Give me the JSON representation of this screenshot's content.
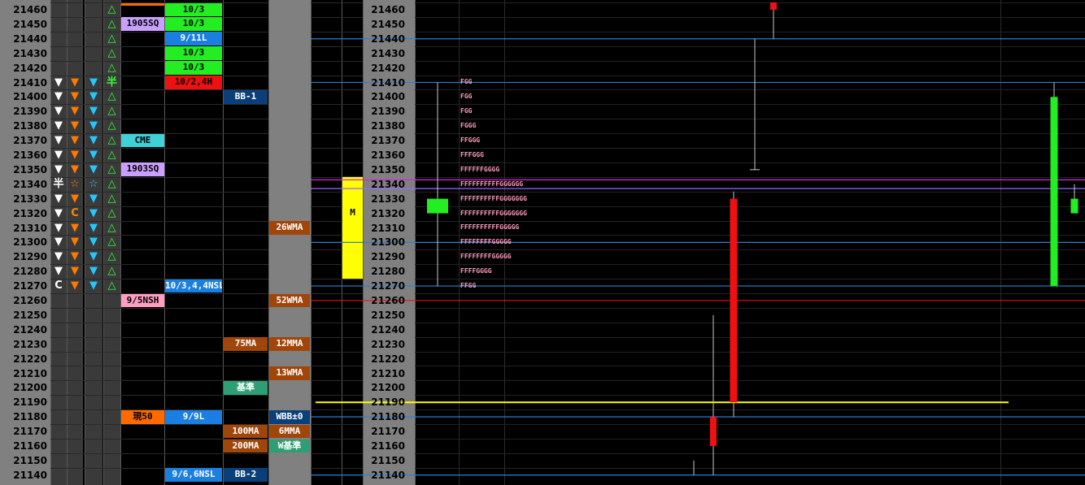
{
  "prices": [
    21460,
    21450,
    21440,
    21430,
    21420,
    21410,
    21400,
    21390,
    21380,
    21370,
    21360,
    21350,
    21340,
    21330,
    21320,
    21310,
    21300,
    21290,
    21280,
    21270,
    21260,
    21250,
    21240,
    21230,
    21220,
    21210,
    21200,
    21190,
    21180,
    21170,
    21160,
    21150,
    21140
  ],
  "markers": [
    {
      "price": 21460,
      "c1": "",
      "c2": "",
      "c3": "",
      "c4": "△"
    },
    {
      "price": 21450,
      "c1": "",
      "c2": "",
      "c3": "",
      "c4": "△"
    },
    {
      "price": 21440,
      "c1": "",
      "c2": "",
      "c3": "",
      "c4": "△"
    },
    {
      "price": 21430,
      "c1": "",
      "c2": "",
      "c3": "",
      "c4": "△"
    },
    {
      "price": 21420,
      "c1": "",
      "c2": "",
      "c3": "",
      "c4": "△"
    },
    {
      "price": 21410,
      "c1": "▼",
      "c2": "▼",
      "c3": "▼",
      "c4": "半"
    },
    {
      "price": 21400,
      "c1": "▼",
      "c2": "▼",
      "c3": "▼",
      "c4": "△"
    },
    {
      "price": 21390,
      "c1": "▼",
      "c2": "▼",
      "c3": "▼",
      "c4": "△"
    },
    {
      "price": 21380,
      "c1": "▼",
      "c2": "▼",
      "c3": "▼",
      "c4": "△"
    },
    {
      "price": 21370,
      "c1": "▼",
      "c2": "▼",
      "c3": "▼",
      "c4": "△"
    },
    {
      "price": 21360,
      "c1": "▼",
      "c2": "▼",
      "c3": "▼",
      "c4": "△"
    },
    {
      "price": 21350,
      "c1": "▼",
      "c2": "▼",
      "c3": "▼",
      "c4": "△"
    },
    {
      "price": 21340,
      "c1": "半",
      "c2": "☆",
      "c3": "☆",
      "c4": "△"
    },
    {
      "price": 21330,
      "c1": "▼",
      "c2": "▼",
      "c3": "▼",
      "c4": "△"
    },
    {
      "price": 21320,
      "c1": "▼",
      "c2": "C",
      "c3": "▼",
      "c4": "△"
    },
    {
      "price": 21310,
      "c1": "▼",
      "c2": "▼",
      "c3": "▼",
      "c4": "△"
    },
    {
      "price": 21300,
      "c1": "▼",
      "c2": "▼",
      "c3": "▼",
      "c4": "△"
    },
    {
      "price": 21290,
      "c1": "▼",
      "c2": "▼",
      "c3": "▼",
      "c4": "△"
    },
    {
      "price": 21280,
      "c1": "▼",
      "c2": "▼",
      "c3": "▼",
      "c4": "△"
    },
    {
      "price": 21270,
      "c1": "C",
      "c2": "▼",
      "c3": "▼",
      "c4": "△"
    }
  ],
  "tags": [
    {
      "price": 21460,
      "col": "a",
      "text": "",
      "bg": "#ff6a00",
      "fg": "#000",
      "thin": true
    },
    {
      "price": 21450,
      "col": "a",
      "text": "1905SQ",
      "bg": "#c9a0ff",
      "fg": "#000"
    },
    {
      "price": 21370,
      "col": "a",
      "text": "CME",
      "bg": "#40d0d8",
      "fg": "#000"
    },
    {
      "price": 21350,
      "col": "a",
      "text": "1903SQ",
      "bg": "#c9a0ff",
      "fg": "#000"
    },
    {
      "price": 21260,
      "col": "a",
      "text": "9/5NSH",
      "bg": "#ff9ec0",
      "fg": "#000"
    },
    {
      "price": 21180,
      "col": "a",
      "text": "現50",
      "bg": "#ff6a00",
      "fg": "#000"
    },
    {
      "price": 21460,
      "col": "b",
      "text": "10/3",
      "bg": "#22ee22",
      "fg": "#000"
    },
    {
      "price": 21450,
      "col": "b",
      "text": "10/3",
      "bg": "#22ee22",
      "fg": "#000"
    },
    {
      "price": 21440,
      "col": "b",
      "text": "9/11L",
      "bg": "#1a7fe0",
      "fg": "#fff"
    },
    {
      "price": 21430,
      "col": "b",
      "text": "10/3",
      "bg": "#22ee22",
      "fg": "#000"
    },
    {
      "price": 21420,
      "col": "b",
      "text": "10/3",
      "bg": "#22ee22",
      "fg": "#000"
    },
    {
      "price": 21410,
      "col": "b",
      "text": "10/2,4H",
      "bg": "#ee1111",
      "fg": "#000"
    },
    {
      "price": 21270,
      "col": "b",
      "text": "10/3,4,4NSL",
      "bg": "#1a7fe0",
      "fg": "#fff"
    },
    {
      "price": 21180,
      "col": "b",
      "text": "9/9L",
      "bg": "#1a7fe0",
      "fg": "#fff"
    },
    {
      "price": 21140,
      "col": "b",
      "text": "9/6,6NSL",
      "bg": "#1a7fe0",
      "fg": "#fff"
    },
    {
      "price": 21400,
      "col": "c",
      "text": "BB-1",
      "bg": "#0b3f7a",
      "fg": "#fff"
    },
    {
      "price": 21230,
      "col": "c",
      "text": "75MA",
      "bg": "#a0460a",
      "fg": "#fff"
    },
    {
      "price": 21200,
      "col": "c",
      "text": "基準",
      "bg": "#2e9e74",
      "fg": "#fff"
    },
    {
      "price": 21170,
      "col": "c",
      "text": "100MA",
      "bg": "#a0460a",
      "fg": "#fff"
    },
    {
      "price": 21160,
      "col": "c",
      "text": "200MA",
      "bg": "#a0460a",
      "fg": "#fff"
    },
    {
      "price": 21140,
      "col": "c",
      "text": "BB-2",
      "bg": "#0b3f7a",
      "fg": "#fff"
    },
    {
      "price": 21310,
      "col": "d",
      "text": "26WMA",
      "bg": "#a0460a",
      "fg": "#fff"
    },
    {
      "price": 21260,
      "col": "d",
      "text": "52WMA",
      "bg": "#a0460a",
      "fg": "#fff"
    },
    {
      "price": 21230,
      "col": "d",
      "text": "12MMA",
      "bg": "#a0460a",
      "fg": "#fff"
    },
    {
      "price": 21210,
      "col": "d",
      "text": "13WMA",
      "bg": "#a0460a",
      "fg": "#fff"
    },
    {
      "price": 21180,
      "col": "d",
      "text": "WBB±0",
      "bg": "#0b3f7a",
      "fg": "#fff"
    },
    {
      "price": 21170,
      "col": "d",
      "text": "6MMA",
      "bg": "#a0460a",
      "fg": "#fff"
    },
    {
      "price": 21160,
      "col": "d",
      "text": "W基準",
      "bg": "#2e9e74",
      "fg": "#fff"
    }
  ],
  "value_area": {
    "top": 21340,
    "bottom": 21280,
    "label": "M",
    "color": "#ffff00"
  },
  "chart_data": {
    "type": "candlestick",
    "ylim": [
      21135,
      21465
    ],
    "tick_step": 10,
    "candles": [
      {
        "name": "c1",
        "open": 21330,
        "close": 21320,
        "high": 21410,
        "low": 21270,
        "color": "#22ee22"
      },
      {
        "name": "c2",
        "open": 21180,
        "close": 21160,
        "high": 21250,
        "low": 21140,
        "color": "#ee1111"
      },
      {
        "name": "c3",
        "open": 21330,
        "close": 21190,
        "high": 21335,
        "low": 21180,
        "color": "#ee1111"
      },
      {
        "name": "c4",
        "open": 21465,
        "close": 21460,
        "high": 21465,
        "low": 21440,
        "color": "#ee1111"
      },
      {
        "name": "c5",
        "open": 21400,
        "close": 21270,
        "high": 21410,
        "low": 21270,
        "color": "#22ee22"
      },
      {
        "name": "c6",
        "open": 21330,
        "close": 21320,
        "high": 21340,
        "low": 21320,
        "color": "#22ee22"
      }
    ],
    "wicks": [
      {
        "high": 21150,
        "low": 21140
      },
      {
        "high": 21440,
        "low": 21350
      }
    ],
    "levels": [
      {
        "price": 21440,
        "color": "#2a7fd0"
      },
      {
        "price": 21410,
        "color": "#2a7fd0"
      },
      {
        "price": 21343,
        "color": "#dd22dd"
      },
      {
        "price": 21337,
        "color": "#9966ff"
      },
      {
        "price": 21300,
        "color": "#2a7fd0"
      },
      {
        "price": 21270,
        "color": "#2a7fd0"
      },
      {
        "price": 21260,
        "color": "#ee1111"
      },
      {
        "price": 21190,
        "color": "#ffff00"
      },
      {
        "price": 21180,
        "color": "#2a7fd0"
      },
      {
        "price": 21140,
        "color": "#2a7fd0"
      }
    ],
    "tpo_rows": [
      {
        "price": 21410,
        "text": "FGG"
      },
      {
        "price": 21400,
        "text": "FGG"
      },
      {
        "price": 21390,
        "text": "FGG"
      },
      {
        "price": 21380,
        "text": "FGGG"
      },
      {
        "price": 21370,
        "text": "FFGGG"
      },
      {
        "price": 21360,
        "text": "FFFGGG"
      },
      {
        "price": 21350,
        "text": "FFFFFFGGGG"
      },
      {
        "price": 21340,
        "text": "FFFFFFFFFFGGGGGG"
      },
      {
        "price": 21330,
        "text": "FFFFFFFFFFGGGGGGG"
      },
      {
        "price": 21320,
        "text": "FFFFFFFFFFGGGGGGG"
      },
      {
        "price": 21310,
        "text": "FFFFFFFFFFGGGGG"
      },
      {
        "price": 21300,
        "text": "FFFFFFFFGGGGG"
      },
      {
        "price": 21290,
        "text": "FFFFFFFFGGGGG"
      },
      {
        "price": 21280,
        "text": "FFFFGGGG"
      },
      {
        "price": 21270,
        "text": "FFGG"
      }
    ]
  }
}
